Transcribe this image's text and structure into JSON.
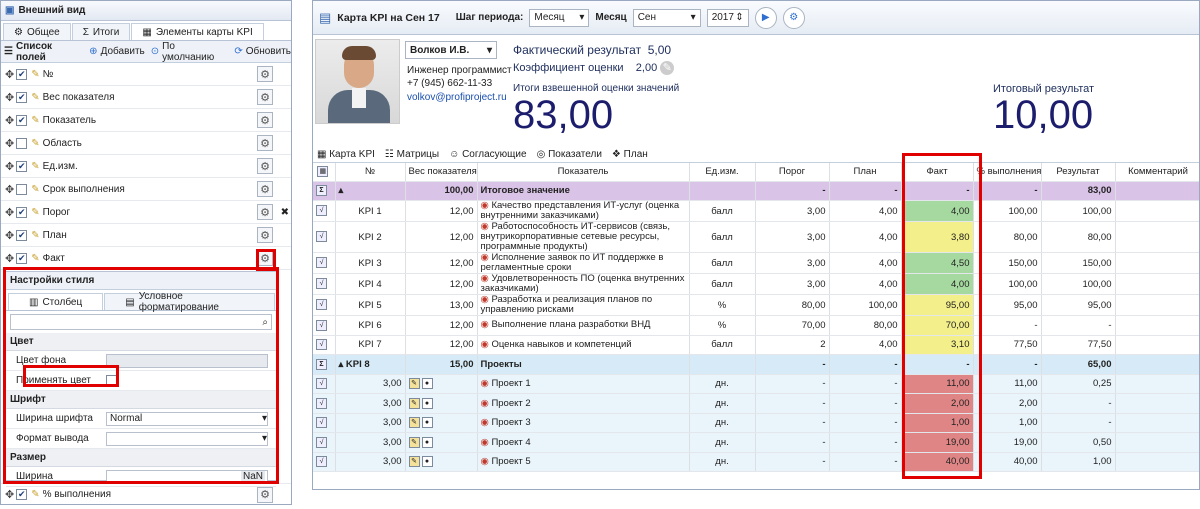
{
  "left": {
    "title": "Внешний вид",
    "tabs": [
      "Общее",
      "Итоги",
      "Элементы карты KPI"
    ],
    "toolbar": {
      "list": "Список полей",
      "add": "Добавить",
      "default": "По умолчанию",
      "refresh": "Обновить"
    },
    "fields": [
      {
        "label": "№",
        "checked": true
      },
      {
        "label": "Вес показателя",
        "checked": true
      },
      {
        "label": "Показатель",
        "checked": true
      },
      {
        "label": "Область",
        "checked": false
      },
      {
        "label": "Ед.изм.",
        "checked": true
      },
      {
        "label": "Срок выполнения",
        "checked": false
      },
      {
        "label": "Порог",
        "checked": true
      },
      {
        "label": "План",
        "checked": true
      },
      {
        "label": "Факт",
        "checked": true
      }
    ],
    "style": {
      "title": "Настройки стиля",
      "tab1": "Столбец",
      "tab2": "Условное форматирование",
      "color_section": "Цвет",
      "bg_label": "Цвет фона",
      "apply_label": "Применять цвет",
      "font_section": "Шрифт",
      "font_width_label": "Ширина шрифта",
      "font_width_value": "Normal",
      "format_label": "Формат вывода",
      "size_section": "Размер",
      "width_label": "Ширина",
      "width_value": "NaN"
    },
    "last_field": "% выполнения"
  },
  "right": {
    "title": "Карта KPI на Сен 17",
    "period_label": "Шаг периода:",
    "period_value": "Месяц",
    "month_label": "Месяц",
    "month_value": "Сен",
    "year_value": "2017",
    "person": {
      "name": "Волков И.В.",
      "position": "Инженер программист",
      "phone": "+7 (945) 662-11-33",
      "email": "volkov@profiproject.ru"
    },
    "fact_label": "Фактический результат",
    "fact_value": "5,00",
    "coef_label": "Коэффициент оценки",
    "coef_value": "2,00",
    "weighted_label": "Итоги взвешенной оценки значений",
    "weighted_value": "83,00",
    "total_label": "Итоговый результат",
    "total_value": "10,00",
    "tabs": [
      "Карта KPI",
      "Матрицы",
      "Согласующие",
      "Показатели",
      "План"
    ],
    "columns": [
      "№",
      "Вес показателя",
      "Показатель",
      "Ед.изм.",
      "Порог",
      "План",
      "Факт",
      "% выполнения",
      "Результат",
      "Комментарий"
    ],
    "group1": {
      "weight": "100,00",
      "name": "Итоговое значение",
      "porog": "-",
      "plan": "-",
      "fact": "-",
      "pct": "-",
      "result": "83,00"
    },
    "rows": [
      {
        "no": "KPI 1",
        "weight": "12,00",
        "name": "Качество представления ИТ-услуг (оценка внутренними заказчиками)",
        "unit": "балл",
        "porog": "3,00",
        "plan": "4,00",
        "fact": "4,00",
        "pct": "100,00",
        "result": "100,00",
        "color": "#a6d9a0"
      },
      {
        "no": "KPI 2",
        "weight": "12,00",
        "name": "Работоспособность ИТ-сервисов (связь, внутрикорпоративные сетевые ресурсы, программные продукты)",
        "unit": "балл",
        "porog": "3,00",
        "plan": "4,00",
        "fact": "3,80",
        "pct": "80,00",
        "result": "80,00",
        "color": "#f3ef8a"
      },
      {
        "no": "KPI 3",
        "weight": "12,00",
        "name": "Исполнение заявок по ИТ поддержке в регламентные сроки",
        "unit": "балл",
        "porog": "3,00",
        "plan": "4,00",
        "fact": "4,50",
        "pct": "150,00",
        "result": "150,00",
        "color": "#a6d9a0"
      },
      {
        "no": "KPI 4",
        "weight": "12,00",
        "name": "Удовлетворенность ПО (оценка внутренних заказчиками)",
        "unit": "балл",
        "porog": "3,00",
        "plan": "4,00",
        "fact": "4,00",
        "pct": "100,00",
        "result": "100,00",
        "color": "#a6d9a0"
      },
      {
        "no": "KPI 5",
        "weight": "13,00",
        "name": "Разработка и реализация планов по управлению рисками",
        "unit": "%",
        "porog": "80,00",
        "plan": "100,00",
        "fact": "95,00",
        "pct": "95,00",
        "result": "95,00",
        "color": "#f3ef8a"
      },
      {
        "no": "KPI 6",
        "weight": "12,00",
        "name": "Выполнение плана разработки ВНД",
        "unit": "%",
        "porog": "70,00",
        "plan": "80,00",
        "fact": "70,00",
        "pct": "-",
        "result": "-",
        "color": "#f3ef8a"
      },
      {
        "no": "KPI 7",
        "weight": "12,00",
        "name": "Оценка навыков и компетенций",
        "unit": "балл",
        "porog": "2",
        "plan": "4,00",
        "fact": "3,10",
        "pct": "77,50",
        "result": "77,50",
        "color": "#f3ef8a"
      }
    ],
    "group2": {
      "no": "KPI 8",
      "weight": "15,00",
      "name": "Проекты",
      "porog": "-",
      "plan": "-",
      "fact": "-",
      "pct": "-",
      "result": "65,00"
    },
    "projects": [
      {
        "weight": "3,00",
        "name": "Проект 1",
        "unit": "дн.",
        "porog": "-",
        "plan": "-",
        "fact": "11,00",
        "pct": "11,00",
        "result": "0,25"
      },
      {
        "weight": "3,00",
        "name": "Проект 2",
        "unit": "дн.",
        "porog": "-",
        "plan": "-",
        "fact": "2,00",
        "pct": "2,00",
        "result": "-"
      },
      {
        "weight": "3,00",
        "name": "Проект 3",
        "unit": "дн.",
        "porog": "-",
        "plan": "-",
        "fact": "1,00",
        "pct": "1,00",
        "result": "-"
      },
      {
        "weight": "3,00",
        "name": "Проект 4",
        "unit": "дн.",
        "porog": "-",
        "plan": "-",
        "fact": "19,00",
        "pct": "19,00",
        "result": "0,50"
      },
      {
        "weight": "3,00",
        "name": "Проект 5",
        "unit": "дн.",
        "porog": "-",
        "plan": "-",
        "fact": "40,00",
        "pct": "40,00",
        "result": "1,00"
      }
    ],
    "colors": {
      "group1": "#d9c3e6",
      "group2": "#d6ebf7",
      "project": "#e9f4fb",
      "project_fact": "#e08585"
    }
  }
}
